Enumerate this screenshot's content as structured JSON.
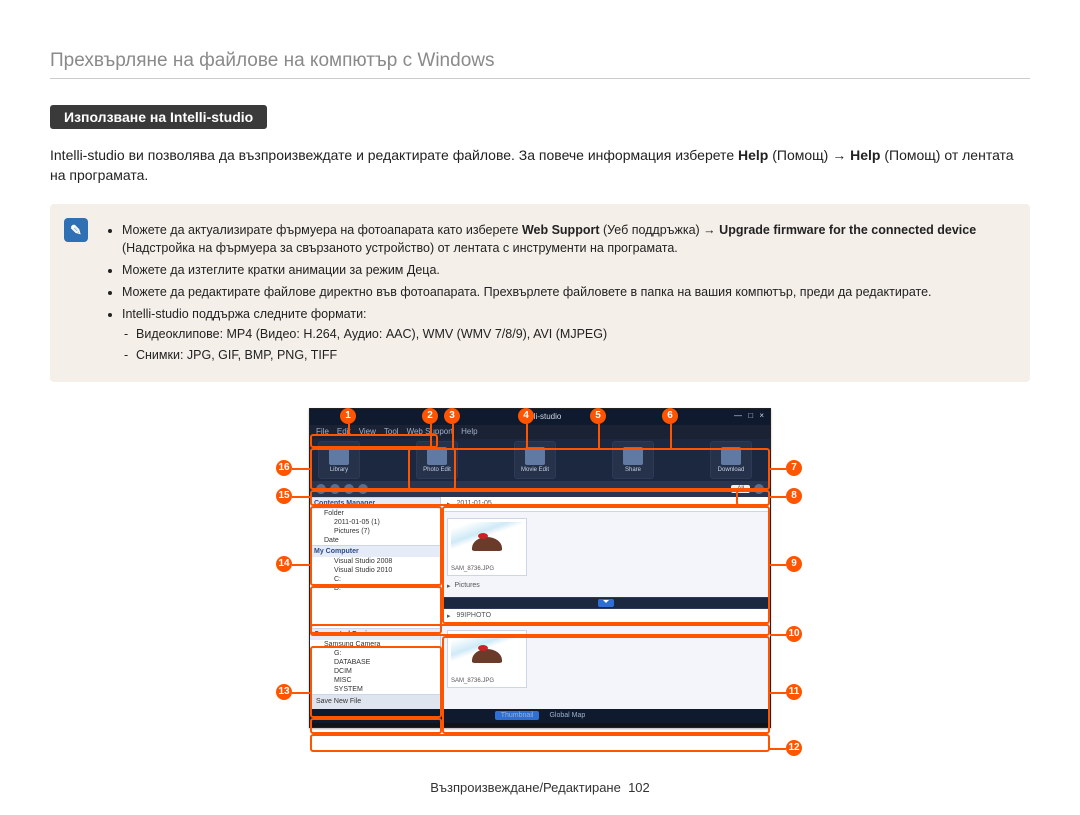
{
  "heading": "Прехвърляне на файлове на компютър с Windows",
  "section_title": "Използване на Intelli-studio",
  "body_html_parts": {
    "p1a": "Intelli-studio ви позволява да възпроизвеждате и редактирате файлове. За повече информация изберете ",
    "p1b": "Help",
    "p1c": " (Помощ) → ",
    "p1d": "Help",
    "p1e": " (Помощ) от лентата на програмата."
  },
  "note": {
    "icon": "✎",
    "li1a": "Можете да актуализирате фърмуера на фотоапарата като изберете ",
    "li1b": "Web Support",
    "li1c": " (Уеб поддръжка) → ",
    "li1d": "Upgrade firmware for the connected device",
    "li1e": " (Надстройка на фърмуера за свързаното устройство) от лентата с инструменти на програмата.",
    "li2": "Можете да изтеглите кратки анимации за режим Деца.",
    "li3": "Можете да редактирате файлове директно във фотоапарата. Прехвърлете файловете в папка на вашия компютър, преди да редактирате.",
    "li4": "Intelli-studio поддържа следните формати:",
    "li4a": "Видеоклипове: MP4 (Видео: H.264, Аудио: AAC), WMV (WMV 7/8/9), AVI (MJPEG)",
    "li4b": "Снимки: JPG, GIF, BMP, PNG, TIFF"
  },
  "app": {
    "title": "Intelli-studio",
    "win_buttons": "— □ ×",
    "menu": [
      "File",
      "Edit",
      "View",
      "Tool",
      "Web Support",
      "Help"
    ],
    "toolbar": [
      {
        "label": "Library"
      },
      {
        "label": "Photo Edit"
      },
      {
        "label": "Movie Edit"
      },
      {
        "label": "Share"
      },
      {
        "label": "Download"
      }
    ],
    "all": "All",
    "breadcrumb1": "2011-01-05",
    "breadcrumb2": "99IPHOTO",
    "thumb1": "SAM_8736.JPG",
    "folder_pictures": "Pictures",
    "thumb2": "SAM_8736.JPG",
    "save_new": "Save New File",
    "footer_tabs": [
      "Thumbnail",
      "Global Map"
    ],
    "sidebar": {
      "sec1": "Contents Manager",
      "sec1_items": [
        "Folder",
        "  2011-01-05   (1)",
        "    Pictures   (7)",
        "Date"
      ],
      "sec2": "My Computer",
      "sec2_items": [
        "Visual Studio 2008",
        "Visual Studio 2010",
        "C:",
        "D:"
      ],
      "sec3": "Connected Device",
      "sec3_items": [
        "Samsung Camera",
        "  G:",
        "    DATABASE",
        "    DCIM",
        "    MISC",
        "    SYSTEM"
      ]
    }
  },
  "callouts": [
    "1",
    "2",
    "3",
    "4",
    "5",
    "6",
    "7",
    "8",
    "9",
    "10",
    "11",
    "12",
    "13",
    "14",
    "15",
    "16"
  ],
  "footer": {
    "label": "Възпроизвеждане/Редактиране",
    "num": "102"
  }
}
